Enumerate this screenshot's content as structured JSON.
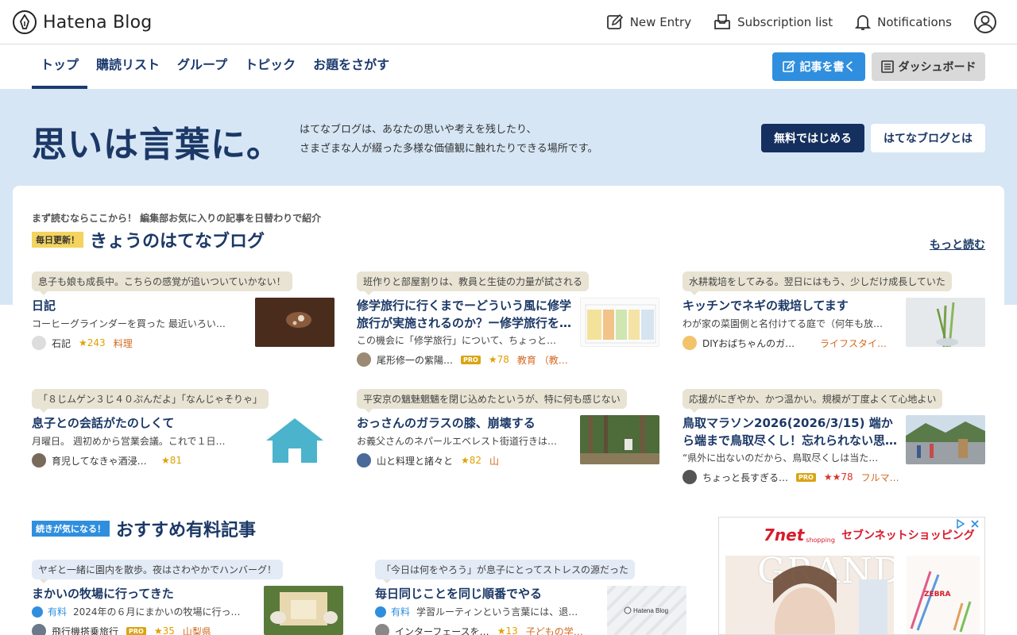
{
  "header": {
    "logo_text": "Hatena Blog",
    "actions": [
      {
        "label": "New Entry",
        "icon": "pencil-icon"
      },
      {
        "label": "Subscription list",
        "icon": "inbox-icon"
      },
      {
        "label": "Notifications",
        "icon": "bell-icon"
      }
    ]
  },
  "nav": {
    "tabs": [
      "トップ",
      "購読リスト",
      "グループ",
      "トピック",
      "お題をさがす"
    ],
    "active_tab": "トップ",
    "write_label": "記事を書く",
    "dashboard_label": "ダッシュボード"
  },
  "hero": {
    "title": "思いは言葉に。",
    "desc_line1": "はてなブログは、あなたの思いや考えを残したり、",
    "desc_line2": "さまざまな人が綴った多様な価値観に触れたりできる場所です。",
    "start_label": "無料ではじめる",
    "about_label": "はてなブログとは"
  },
  "today": {
    "eyebrow": "まず読むならここから！ 編集部お気に入りの記事を日替わりで紹介",
    "badge": "毎日更新！",
    "title": "きょうのはてなブログ",
    "more": "もっと読む",
    "cards": [
      {
        "bubble": "息子も娘も成長中。こちらの感覚が追いついていかない！",
        "title": "日記",
        "excerpt": "コーヒーグラインダーを買った 最近いろい…",
        "author": "石記",
        "pro": "",
        "stars": "★243",
        "tag": "料理"
      },
      {
        "bubble": "班作りと部屋割りは、教員と生徒の力量が試される",
        "title": "修学旅行に行くまでーどういう風に修学旅行が実施されるのか？ー修学旅行を…",
        "excerpt": "この機会に「修学旅行」について、ちょっと…",
        "author": "尾形修一の紫陽…",
        "pro": "PRO",
        "stars": "★78",
        "tag": "教育 （教…"
      },
      {
        "bubble": "水耕栽培をしてみる。翌日にはもう、少しだけ成長していた",
        "title": "キッチンでネギの栽培してます",
        "excerpt": "わが家の菜園側と名付けてる庭で（何年も放…",
        "author": "DIYおばちゃんのガー…",
        "pro": "",
        "stars": "",
        "tag": "ライフスタイ…"
      },
      {
        "bubble": "「８じムゲン３じ４０ぷんだよ」「なんじゃそりゃ」",
        "title": "息子との会話がたのしくて",
        "excerpt": "月曜日。 週初めから営業会議。これで１日…",
        "author": "育児してなきゃ酒浸り…",
        "pro": "",
        "stars": "★81",
        "tag": ""
      },
      {
        "bubble": "平安京の魑魅魍魎を閉じ込めたというが、特に何も感じない",
        "title": "おっさんのガラスの膝、崩壊する",
        "excerpt": "お義父さんのネパールエベレスト街道行きは…",
        "author": "山と料理と諸々と",
        "pro": "",
        "stars": "★82",
        "tag": "山"
      },
      {
        "bubble": "応援がにぎやか、かつ温かい。規模が丁度よくて心地よい",
        "title": "鳥取マラソン2026(2026/3/15) 端から端まで鳥取尽くし！忘れられない思…",
        "excerpt": "“県外に出ないのだから、鳥取尽くしは当た…",
        "author": "ちょっと長すぎる…",
        "pro": "PRO",
        "stars": "★★78",
        "tag": "フルマ…"
      }
    ]
  },
  "paid": {
    "badge": "続きが気になる！",
    "title": "おすすめ有料記事",
    "paid_label": "有料",
    "cards": [
      {
        "bubble": "ヤギと一緒に園内を散歩。夜はさわやかでハンバーグ！",
        "title": "まかいの牧場に行ってきた",
        "excerpt": "2024年の６月にまかいの牧場に行っ…",
        "author": "飛行機搭乗旅行",
        "pro": "PRO",
        "stars": "★35",
        "tag": "山梨県"
      },
      {
        "bubble": "「今日は何をやろう」が息子にとってストレスの源だった",
        "title": "毎日同じことを同じ順番でやる",
        "excerpt": "学習ルーティンという言葉には、退…",
        "author": "インターフェースを…",
        "pro": "",
        "stars": "★13",
        "tag": "子どもの学…"
      }
    ]
  },
  "ad": {
    "brand": "7net",
    "brand_sub": "shopping",
    "headline": "セブンネットショッピング",
    "magazine": "GRAND",
    "zebra": "ZEBRA"
  },
  "colors": {
    "navy": "#1b3866",
    "blue": "#2f8fde",
    "hero_bg": "#d6e6f5",
    "bubble": "#e8e3d3",
    "star": "#e0a100",
    "tag": "#d2691e"
  }
}
